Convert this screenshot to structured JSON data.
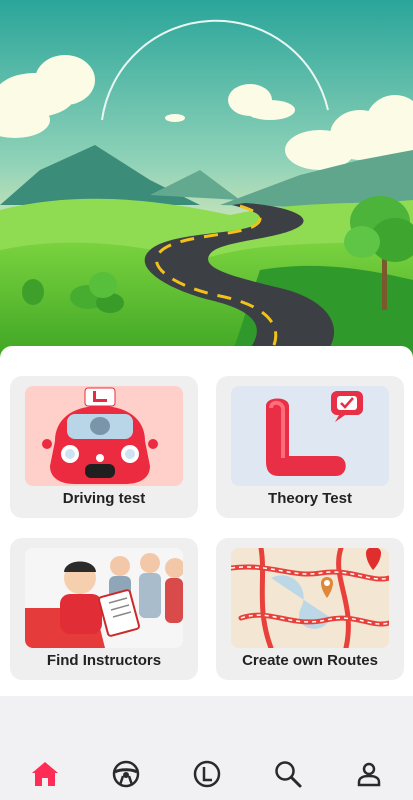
{
  "cards": [
    {
      "label": "Driving test",
      "icon": "red-car-learner-image"
    },
    {
      "label": "Theory Test",
      "icon": "learner-l-plate-image"
    },
    {
      "label": "Find Instructors",
      "icon": "instructors-image"
    },
    {
      "label": "Create own Routes",
      "icon": "route-map-image"
    }
  ],
  "bottom_nav": [
    {
      "icon": "home-icon",
      "active": true
    },
    {
      "icon": "steering-wheel-icon",
      "active": false
    },
    {
      "icon": "learner-plate-icon",
      "active": false
    },
    {
      "icon": "search-icon",
      "active": false
    },
    {
      "icon": "profile-icon",
      "active": false
    }
  ],
  "colors": {
    "accent": "#ff2d55",
    "nav_icon": "#2a2a2a",
    "card_bg": "#efefef"
  }
}
